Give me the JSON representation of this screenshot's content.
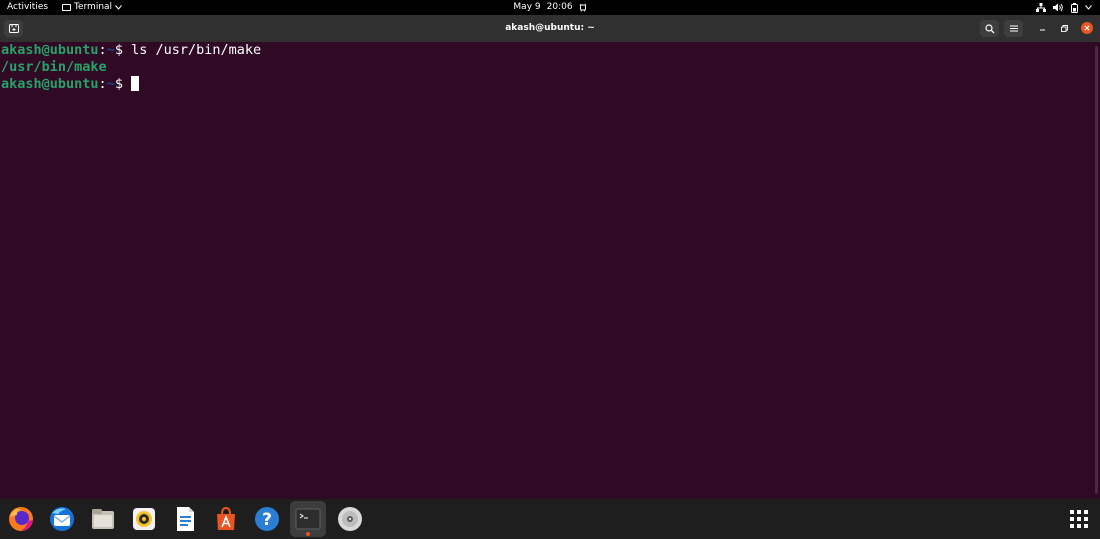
{
  "topbar": {
    "activities": "Activities",
    "app_menu": "Terminal",
    "date": "May 9",
    "time": "20:06"
  },
  "window": {
    "title": "akash@ubuntu: ~"
  },
  "terminal": {
    "line1": {
      "user_host": "akash@ubuntu",
      "colon": ":",
      "path": "~",
      "prompt": "$ ",
      "command": "ls /usr/bin/make"
    },
    "line2": {
      "output": "/usr/bin/make"
    },
    "line3": {
      "user_host": "akash@ubuntu",
      "colon": ":",
      "path": "~",
      "prompt": "$ "
    }
  },
  "dock": {
    "items": [
      "firefox-icon",
      "thunderbird-icon",
      "files-icon",
      "rhythmbox-icon",
      "libreoffice-writer-icon",
      "ubuntu-software-icon",
      "help-icon",
      "terminal-icon",
      "dvd-drive-icon"
    ],
    "active_item": "terminal-icon",
    "show_apps": "show-applications-icon"
  },
  "colors": {
    "terminal_bg": "#300a24",
    "prompt_user": "#26a269",
    "prompt_path": "#12488b",
    "accent": "#e95420"
  }
}
